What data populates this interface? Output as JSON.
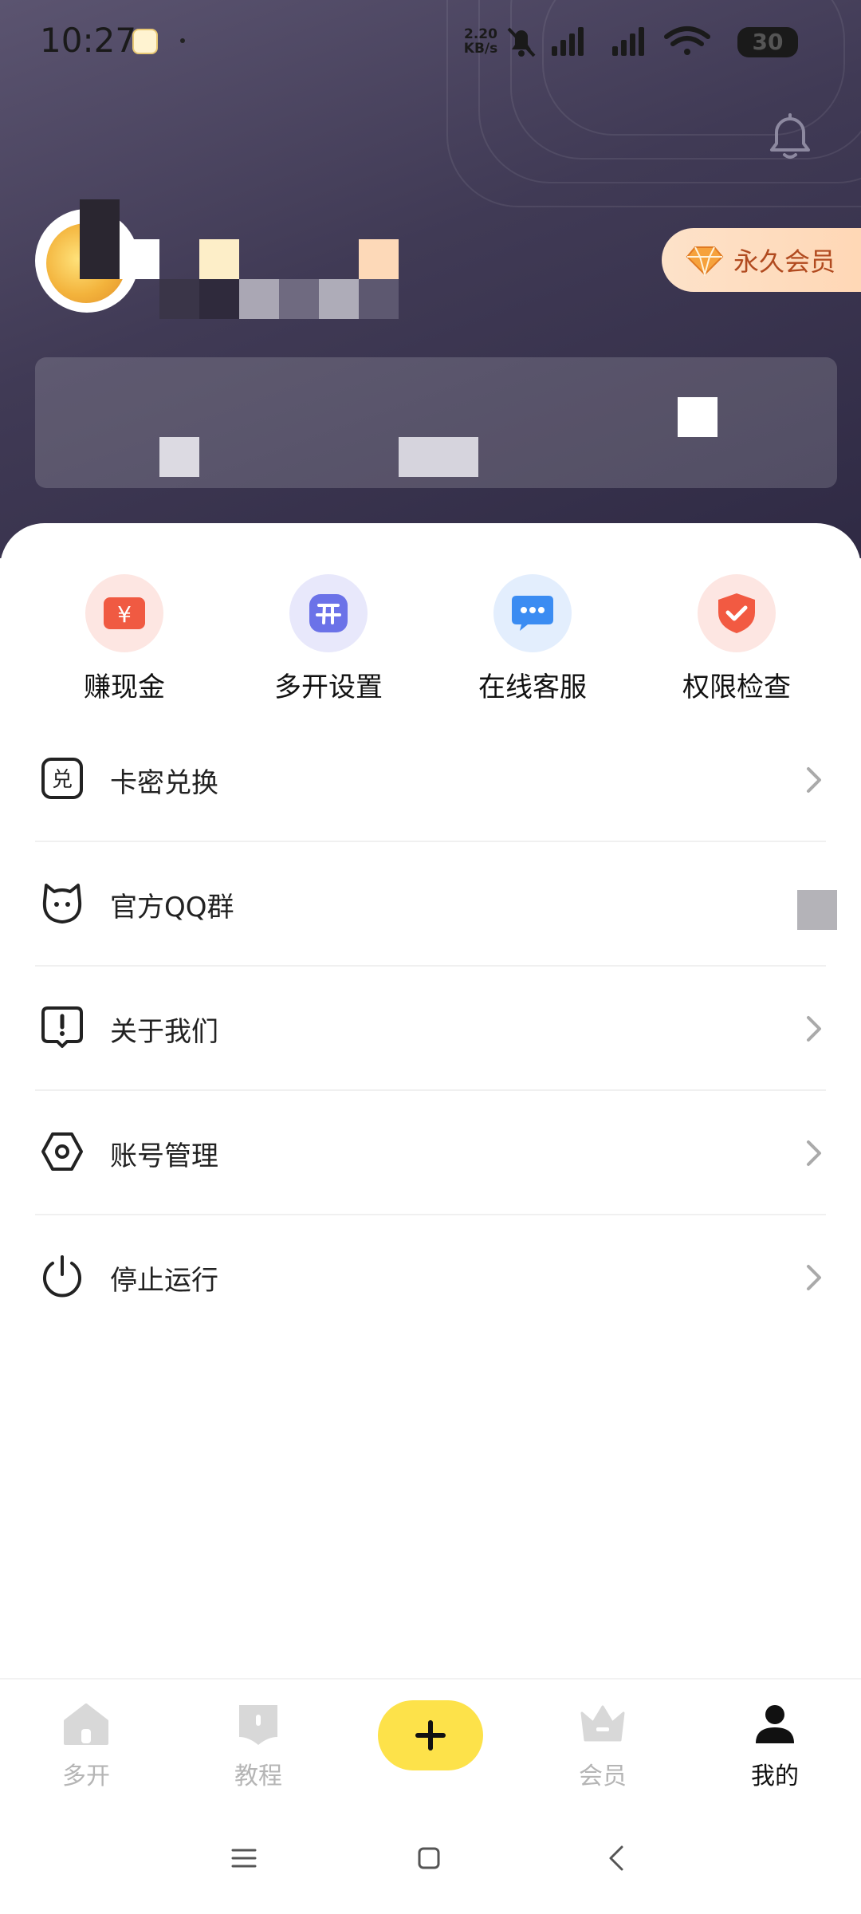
{
  "status_bar": {
    "time": "10:27",
    "net_speed_value": "2.20",
    "net_speed_unit": "KB/s",
    "battery": "30"
  },
  "profile": {
    "vip_badge": "永久会员"
  },
  "quick_actions": [
    {
      "label": "赚现金",
      "icon": "yuan-icon",
      "color": "#f05a42",
      "bg": "#fde6e2"
    },
    {
      "label": "多开设置",
      "icon": "open-icon",
      "color": "#6b72e8",
      "bg": "#e8e8fb"
    },
    {
      "label": "在线客服",
      "icon": "chat-icon",
      "color": "#3b8cf2",
      "bg": "#e3eefd"
    },
    {
      "label": "权限检查",
      "icon": "shield-icon",
      "color": "#f25a42",
      "bg": "#fde6e2"
    }
  ],
  "menu": [
    {
      "label": "卡密兑换",
      "icon": "redeem-icon"
    },
    {
      "label": "官方QQ群",
      "icon": "qq-icon"
    },
    {
      "label": "关于我们",
      "icon": "info-icon"
    },
    {
      "label": "账号管理",
      "icon": "hexagon-icon"
    },
    {
      "label": "停止运行",
      "icon": "power-icon"
    }
  ],
  "bottom_nav": {
    "items": [
      {
        "label": "多开",
        "icon": "home-icon"
      },
      {
        "label": "教程",
        "icon": "book-icon"
      },
      {
        "label": "会员",
        "icon": "crown-icon"
      },
      {
        "label": "我的",
        "icon": "user-icon"
      }
    ],
    "center_icon": "plus-icon",
    "active_color": "#111111",
    "accent_color": "#fde24a"
  },
  "system_nav": {
    "icons": [
      "menu-icon",
      "home-square-icon",
      "back-icon"
    ]
  }
}
